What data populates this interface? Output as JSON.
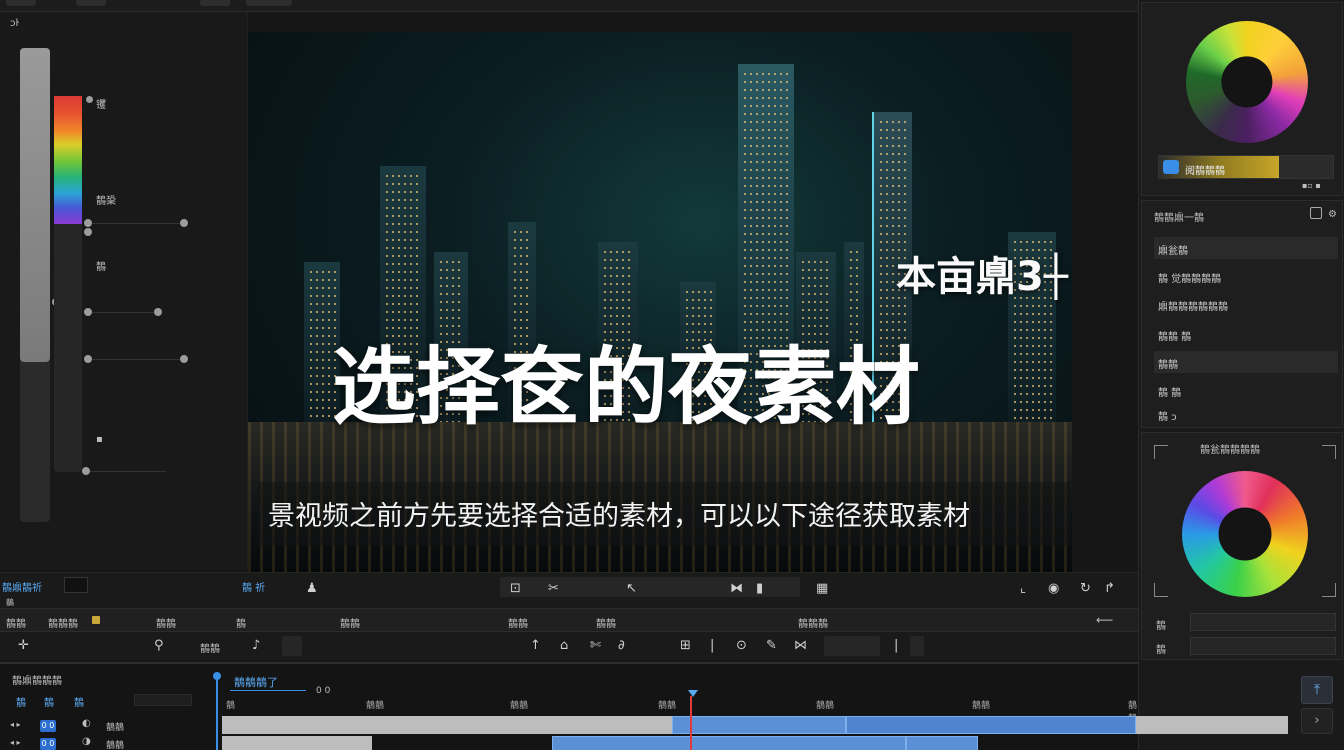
{
  "preview": {
    "big_title": "选择奁的夜素材",
    "small_title": "本亩鼑3┼",
    "subtitle": "景视频之前方先要选择合适的素材，可以以下途径获取素材"
  },
  "left_panel": {
    "top_label": "ɔŀ",
    "labels": [
      "䦆",
      "鶄䅃",
      "鶄",
      "▪"
    ]
  },
  "right_panel": {
    "color_bar_label": "阅鶄鶄鶄",
    "color_bar_value": "▪▫ ▪",
    "list_title": "鶄鶄鼑一鶄",
    "list_items": [
      "鼑瓮鶄",
      "鶄 觉鶄鶄鶄鶄",
      "鼑鶄鶄鶄鶄鶄鶄",
      "鶄鶄 鶄",
      "鶄鶄",
      "鶄 鶄",
      "鶄 ɔ"
    ],
    "wheel2_title": "鶄瓮鶄鶄鶄鶄",
    "field1_label": "鶄",
    "field2_label": "鶄"
  },
  "toolbar1": {
    "left_label": "鶄鼑鶄祈",
    "mid_label": "鶄 祈",
    "small_label": "鶄"
  },
  "toolbar2": {
    "labels": [
      "鶄鶄",
      "鶄鶄鶄",
      "鶄鶄",
      "鶄",
      "鶄鶄",
      "鶄鶄",
      "鶄鶄",
      "鶄鶄鶄"
    ]
  },
  "toolbar3": {
    "label": "鶄鶄"
  },
  "timeline": {
    "header": "鶄鼑鶄鶄鶄",
    "tabs": [
      "鶄",
      "鶄",
      "鶄"
    ],
    "clip_label": "鶄鶄鶄了",
    "clip_counter": "0 0",
    "ruler": [
      "鶄",
      "鶄鶄",
      "鶄鶄",
      "鶄鶄",
      "鶄鶄",
      "鶄鶄",
      "鶄鶄"
    ],
    "track1_label": "鶄鶄",
    "track2_label": "鶄鶄",
    "badge1": "0 0",
    "badge2": "0 0"
  },
  "colors": {
    "accent": "#2d6fd0",
    "clip_blue": "#5b8fd6",
    "playhead": "#e03a3a"
  }
}
